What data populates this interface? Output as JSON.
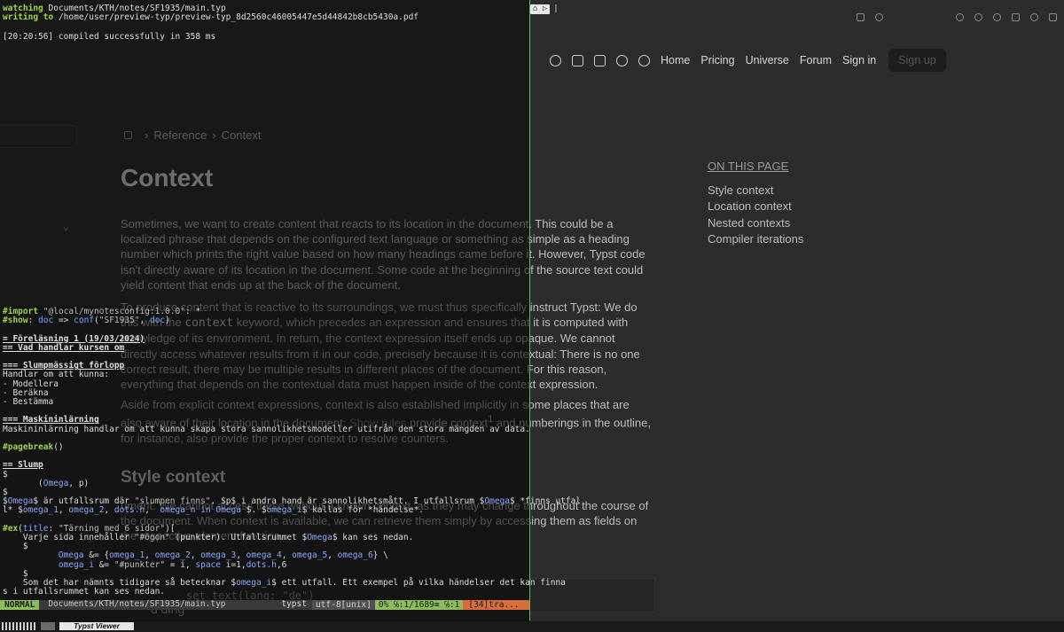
{
  "doc": {
    "nav": {
      "links": [
        "Home",
        "Pricing",
        "Universe",
        "Forum",
        "Sign in"
      ],
      "signup": "Sign up",
      "icons": [
        "github-icon",
        "discord-icon",
        "mastodon-icon",
        "bluesky-icon",
        "fediverse-icon"
      ]
    },
    "breadcrumb": [
      "Reference",
      "Context"
    ],
    "title": "Context",
    "paragraphs": [
      "Sometimes, we want to create content that reacts to its location in the document. This could be a localized phrase that depends on the configured text language or something as simple as a heading number which prints the right value based on how many headings came before it. However, Typst code isn't directly aware of its location in the document. Some code at the beginning of the source text could yield content that ends up at the back of the document.",
      "To produce content that is reactive to its surroundings, we must thus specifically instruct Typst: We do this with the",
      "context",
      "keyword, which precedes an expression and ensures that it is computed with knowledge of its environment. In return, the context expression itself ends up opaque. We cannot directly access whatever results from it in our code, precisely because it is contextual: There is no one correct result, there may be multiple results in different places of the document. For this reason, everything that depends on the contextual data must happen inside of the context expression.",
      "Aside from explicit context expressions, context is also established implicitly in some places that are also aware of their location in the document:",
      "Show rules",
      "provide context",
      "1",
      "and numberings in the outline, for instance, also provide the proper context to resolve counters."
    ],
    "h2": "Style context",
    "style_para": "ument. We cannot access these without a known context, as they may change throughout the course of the document. When context is available, we can retrieve them simply by accessing them as fields on the respective element function.",
    "code_snip": "set text(lang: \"de\")",
    "bottom_head": "d ding",
    "toc": {
      "heading": "ON THIS PAGE",
      "items": [
        "Style context",
        "Location context",
        "Nested contexts",
        "Compiler iterations"
      ]
    }
  },
  "terminal": {
    "watch_label": "watching",
    "watch_path": "Documents/KTH/notes/SF1935/main.typ",
    "write_label": "writing to",
    "write_path": "/home/user/preview-typ/preview-typ_8d2560c46005447e5d44842b8cb5430a.pdf",
    "compiled": "[20:20:56] compiled successfully in 358 ms"
  },
  "editor": {
    "lines": [
      "#import \"@local/mynotesconfig:1.0.0\": *",
      "#show: doc => conf(\"SF1935\", doc)",
      "",
      "= Föreläsning 1 (19/03/2024)",
      "== Vad handlar kursen om",
      "",
      "=== Slumpmässigt förlopp",
      "Handlar om att kunna:",
      "- Modellera",
      "- Beräkna",
      "- Bestämma",
      "",
      "=== Maskininlärning",
      "Maskininlärning handlar om att kunna skapa stora sannolikhetsmodeller utifrån den stora mängden av data.",
      "",
      "#pagebreak()",
      "",
      "== Slump",
      "$",
      "       (Omega, p)",
      "$",
      "$Omega$ är utfallsrum där \"slumpen finns\". $p$ i andra hand är sannolikhetsmått. I utfallsrum $Omega$ *finns utfal",
      "l* $omega_1, omega_2, dots.h,  omega_n in Omega $. $omega_i$ kallas för *händelse*.",
      "",
      "#ex(title: \"Tärning med 6 sidor\")[",
      "    Varje sida innehåller \"#ögon\" (punkter). Utfallsrummet $Omega$ kan ses nedan.",
      "    $",
      "           Omega &= {omega_1, omega_2, omega_3, omega_4, omega_5, omega_6} \\",
      "           omega_i &= \"#punkter\" = i, space i=1,dots.h,6",
      "    $",
      "    Som det har nämnts tidigare så betecknar $omega_i$ ett utfall. Ett exempel på vilka händelser det kan finna",
      "s i utfallsrummet kan ses nedan."
    ],
    "status": {
      "mode": "NORMAL",
      "path": "Documents/KTH/notes/SF1935/main.typ",
      "filetype": "typst",
      "encoding": "utf-8[unix]",
      "position": "0% ℅:1/1689≡ ℅:1",
      "trail": "[34]tra..."
    }
  },
  "pane": {
    "tab": "⌂ ▷",
    "cursor": "|"
  },
  "taskbar": {
    "viewer": "Typst Viewer"
  },
  "colors": {
    "accent_green": "#8bbd5c",
    "divider": "#6eb93f",
    "status_orange": "#d86c3c"
  }
}
